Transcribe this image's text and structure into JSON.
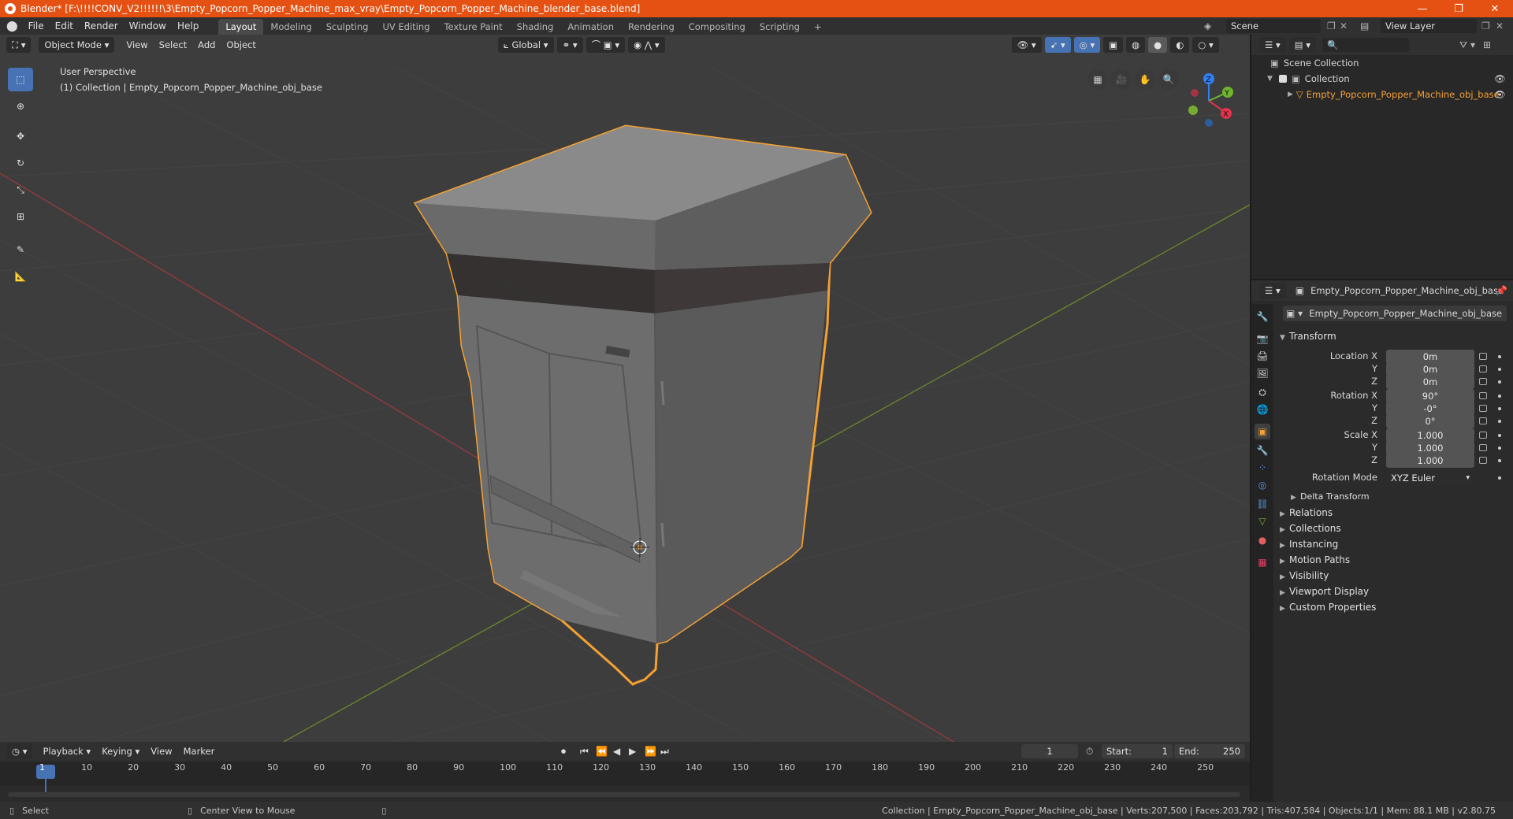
{
  "window": {
    "title": "Blender* [F:\\!!!!CONV_V2!!!!!!\\3\\Empty_Popcorn_Popper_Machine_max_vray\\Empty_Popcorn_Popper_Machine_blender_base.blend]",
    "minimize": "—",
    "maximize": "❐",
    "close": "✕"
  },
  "menu": [
    "File",
    "Edit",
    "Render",
    "Window",
    "Help"
  ],
  "workspaces": [
    "Layout",
    "Modeling",
    "Sculpting",
    "UV Editing",
    "Texture Paint",
    "Shading",
    "Animation",
    "Rendering",
    "Compositing",
    "Scripting"
  ],
  "active_workspace": "Layout",
  "add_workspace": "+",
  "scene": {
    "label": "Scene",
    "view_layer": "View Layer"
  },
  "viewport": {
    "mode": "Object Mode",
    "menus": [
      "View",
      "Select",
      "Add",
      "Object"
    ],
    "orientation": "Global",
    "overlay_title": "User Perspective",
    "overlay_sub": "(1) Collection | Empty_Popcorn_Popper_Machine_obj_base",
    "gizmo": {
      "x": "X",
      "y": "Y",
      "z": "Z"
    }
  },
  "outliner": {
    "root": "Scene Collection",
    "collection": "Collection",
    "object": "Empty_Popcorn_Popper_Machine_obj_base"
  },
  "properties": {
    "header_object": "Empty_Popcorn_Popper_Machine_obj_base",
    "object_name": "Empty_Popcorn_Popper_Machine_obj_base",
    "transform_title": "Transform",
    "location_x_label": "Location X",
    "location_x": "0m",
    "location_y_label": "Y",
    "location_y": "0m",
    "location_z_label": "Z",
    "location_z": "0m",
    "rotation_x_label": "Rotation X",
    "rotation_x": "90°",
    "rotation_y_label": "Y",
    "rotation_y": "-0°",
    "rotation_z_label": "Z",
    "rotation_z": "0°",
    "scale_x_label": "Scale X",
    "scale_x": "1.000",
    "scale_y_label": "Y",
    "scale_y": "1.000",
    "scale_z_label": "Z",
    "scale_z": "1.000",
    "rotation_mode_label": "Rotation Mode",
    "rotation_mode": "XYZ Euler",
    "delta_transform": "Delta Transform",
    "panels": [
      "Relations",
      "Collections",
      "Instancing",
      "Motion Paths",
      "Visibility",
      "Viewport Display",
      "Custom Properties"
    ]
  },
  "timeline": {
    "menus": [
      "Playback",
      "Keying",
      "View",
      "Marker"
    ],
    "current_frame": "1",
    "start_label": "Start:",
    "start": "1",
    "end_label": "End:",
    "end": "250",
    "ticks": [
      "1",
      "10",
      "20",
      "30",
      "40",
      "50",
      "60",
      "70",
      "80",
      "90",
      "100",
      "110",
      "120",
      "130",
      "140",
      "150",
      "160",
      "170",
      "180",
      "190",
      "200",
      "210",
      "220",
      "230",
      "240",
      "250"
    ]
  },
  "status": {
    "select": "Select",
    "center_view": "Center View to Mouse",
    "stats": "Collection | Empty_Popcorn_Popper_Machine_obj_base | Verts:207,500 | Faces:203,792 | Tris:407,584 | Objects:1/1 | Mem: 88.1 MB | v2.80.75"
  },
  "colors": {
    "accent": "#4772b3",
    "title_bar": "#e45112",
    "selection_outline": "#f5a033",
    "viewport_bg": "#3d3d3d"
  }
}
